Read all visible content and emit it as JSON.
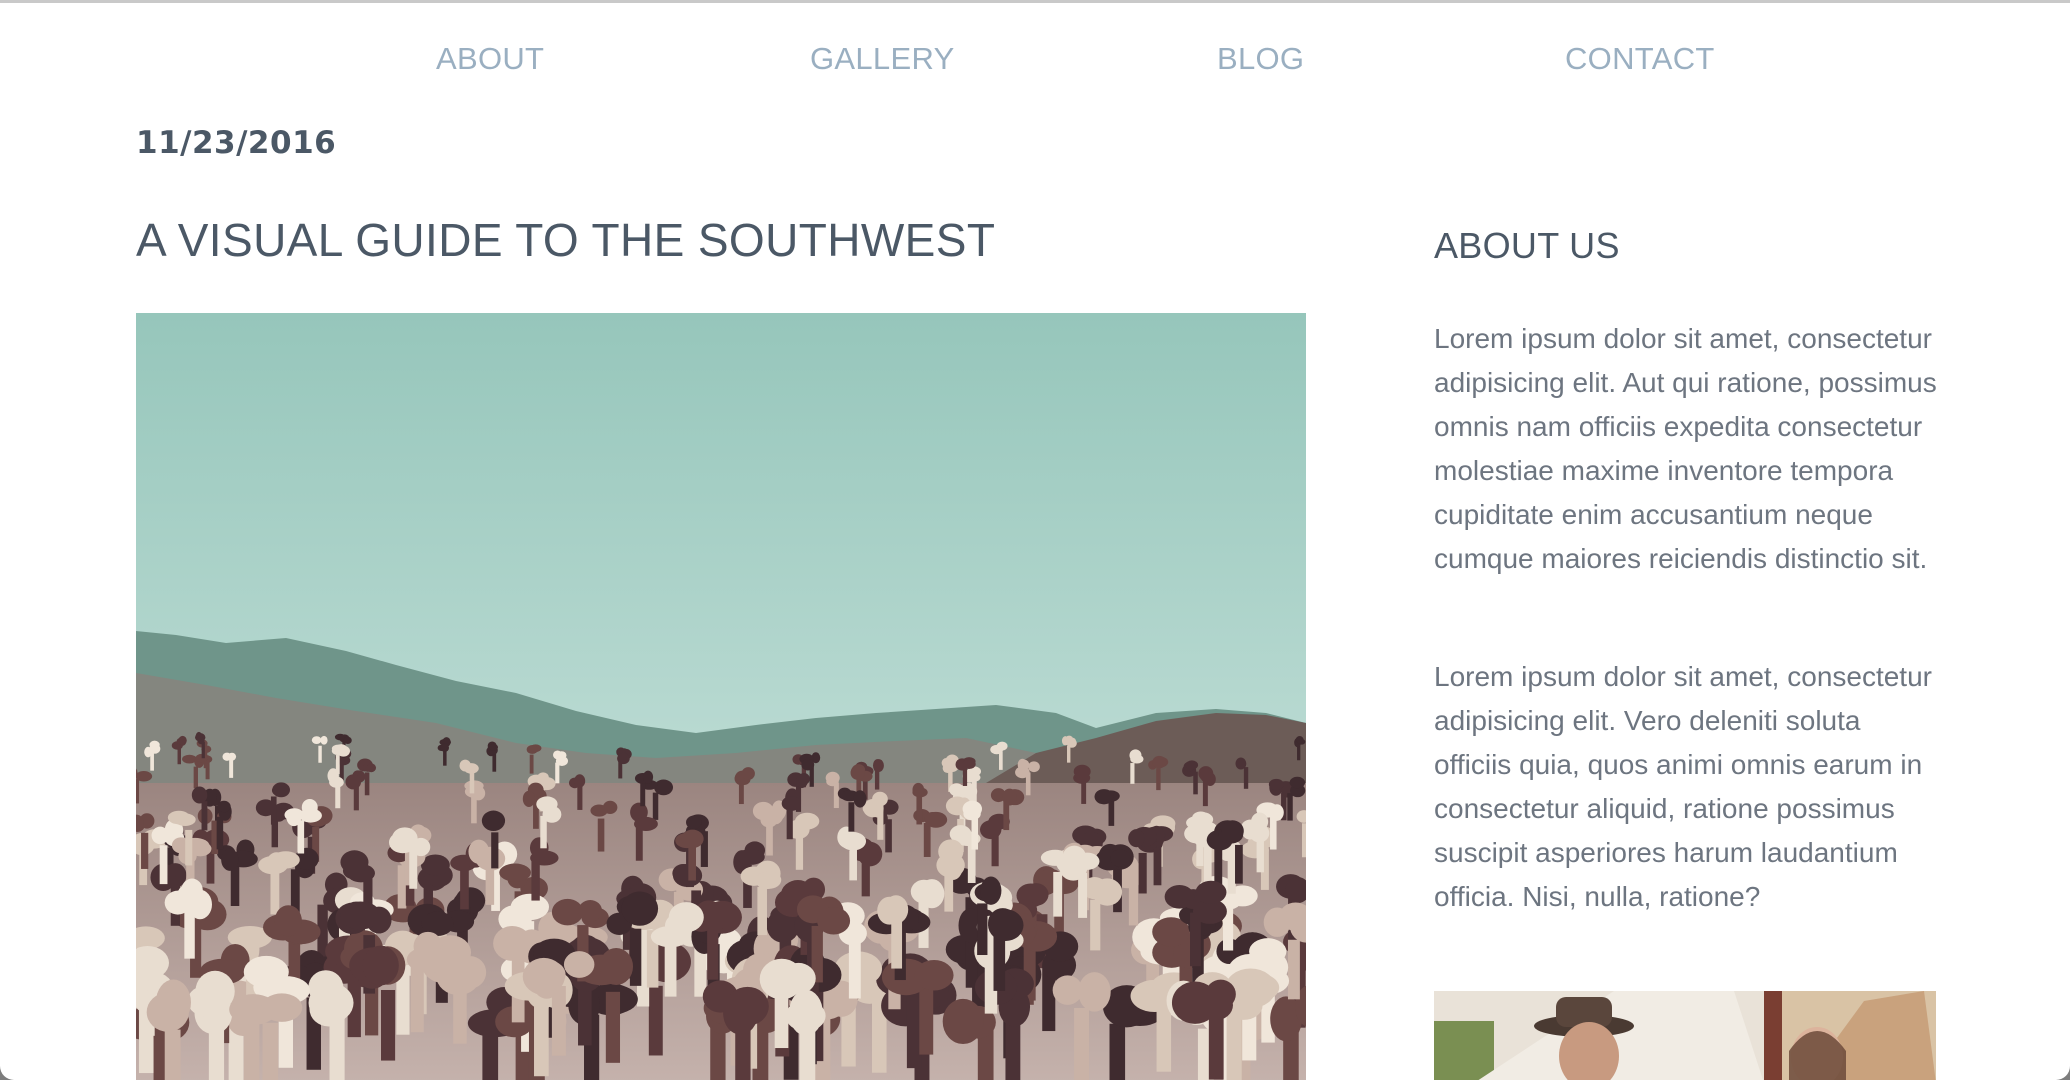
{
  "nav": {
    "items": [
      {
        "label": "ABOUT"
      },
      {
        "label": "GALLERY"
      },
      {
        "label": "BLOG"
      },
      {
        "label": "CONTACT"
      }
    ]
  },
  "post": {
    "date": "11/23/2016",
    "title": "A VISUAL GUIDE TO THE SOUTHWEST",
    "image_subject": "desert landscape with cholla cacti and mountains"
  },
  "sidebar": {
    "title": "ABOUT US",
    "paragraphs": [
      "Lorem ipsum dolor sit amet, consectetur adipisicing elit. Aut qui ratione, possimus omnis nam officiis expedita consectetur molestiae maxime inventore tempora cupiditate enim accusantium neque cumque maiores reiciendis distinctio sit.",
      "Lorem ipsum dolor sit amet, consectetur adipisicing elit. Vero deleniti soluta officiis quia, quos animi omnis earum in consectetur aliquid, ratione possimus suscipit asperiores harum laudantium officia. Nisi, nulla, ratione?"
    ],
    "image_subject": "two people smiling in front of a tent"
  },
  "colors": {
    "nav_text": "#9aafc1",
    "heading_text": "#4b5866",
    "body_text": "#6d7580",
    "sky": "#9ecbc0",
    "desert": "#b8a39e"
  }
}
